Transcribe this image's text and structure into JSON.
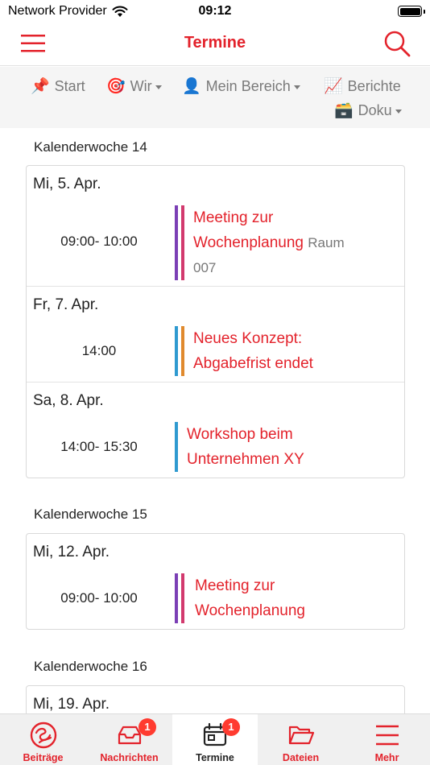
{
  "status_bar": {
    "carrier": "Network Provider",
    "time": "09:12"
  },
  "nav": {
    "title": "Termine"
  },
  "submenu": {
    "items": [
      {
        "emoji": "📌",
        "label": "Start",
        "dropdown": false
      },
      {
        "emoji": "🎯",
        "label": "Wir",
        "dropdown": true
      },
      {
        "emoji": "👤",
        "label": "Mein Bereich",
        "dropdown": true
      },
      {
        "emoji": "📈",
        "label": "Berichte",
        "dropdown": false
      },
      {
        "emoji": "🗃️",
        "label": "Doku",
        "dropdown": true
      }
    ]
  },
  "weeks": [
    {
      "title": "Kalenderwoche 14",
      "days": [
        {
          "date": "Mi, 5. Apr.",
          "time": "09:00- 10:00",
          "event_line1": "Meeting zur",
          "event_line2": "Wochenplanung",
          "location_part1": "Raum",
          "location_part2": "007",
          "bar_colors": [
            "#7b3fb5",
            "#d23a6e"
          ]
        },
        {
          "date": "Fr, 7. Apr.",
          "time": "14:00",
          "event_line1": "Neues Konzept:",
          "event_line2": "Abgabefrist endet",
          "bar_colors": [
            "#2f9ad0",
            "#e08a2e"
          ]
        },
        {
          "date": "Sa, 8. Apr.",
          "time": "14:00- 15:30",
          "event_line1": "Workshop beim",
          "event_line2": "Unternehmen XY",
          "bar_colors": [
            "#2f9ad0"
          ]
        }
      ]
    },
    {
      "title": "Kalenderwoche 15",
      "days": [
        {
          "date": "Mi, 12. Apr.",
          "time": "09:00- 10:00",
          "event_line1": "Meeting zur",
          "event_line2": "Wochenplanung",
          "bar_colors": [
            "#7b3fb5",
            "#d23a6e"
          ]
        }
      ]
    },
    {
      "title": "Kalenderwoche 16",
      "days": [
        {
          "date": "Mi, 19. Apr."
        }
      ]
    }
  ],
  "tabs": [
    {
      "label": "Beiträge",
      "active": false
    },
    {
      "label": "Nachrichten",
      "active": false,
      "badge": "1"
    },
    {
      "label": "Termine",
      "active": true,
      "badge": "1"
    },
    {
      "label": "Dateien",
      "active": false
    },
    {
      "label": "Mehr",
      "active": false
    }
  ],
  "colors": {
    "accent": "#e3222b",
    "badge": "#ff3b30"
  }
}
